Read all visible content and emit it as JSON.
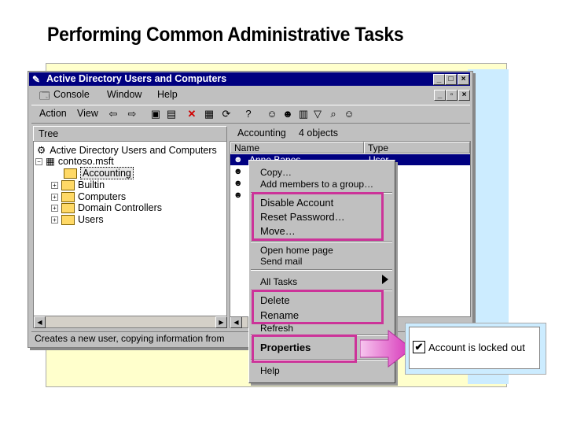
{
  "slide_title": "Performing Common Administrative Tasks",
  "window": {
    "title": "Active Directory Users and Computers",
    "menu": {
      "console": "Console",
      "window": "Window",
      "help": "Help"
    },
    "toolbar": {
      "action": "Action",
      "view": "View"
    },
    "tree_header": "Tree",
    "tree": {
      "root": "Active Directory Users and Computers",
      "domain": "contoso.msft",
      "items": [
        "Accounting",
        "Builtin",
        "Computers",
        "Domain Controllers",
        "Users"
      ]
    },
    "right_header": {
      "container": "Accounting",
      "count": "4 objects"
    },
    "columns": {
      "name": "Name",
      "type": "Type"
    },
    "rows": [
      {
        "name": "Anne Bapes",
        "type": "User"
      }
    ],
    "status": "Creates a new user, copying information from"
  },
  "context_menu": {
    "copy": "Copy…",
    "add_to_group": "Add members to a group…",
    "disable": "Disable Account",
    "reset": "Reset Password…",
    "move": "Move…",
    "open_home": "Open home page",
    "send_mail": "Send mail",
    "all_tasks": "All Tasks",
    "delete": "Delete",
    "rename": "Rename",
    "refresh": "Refresh",
    "properties": "Properties",
    "help": "Help"
  },
  "callout": {
    "text": "Account is locked out",
    "checked": true
  },
  "colors": {
    "highlight": "#cc3399",
    "titlebar": "#000080",
    "arrow": "#e066cc"
  }
}
